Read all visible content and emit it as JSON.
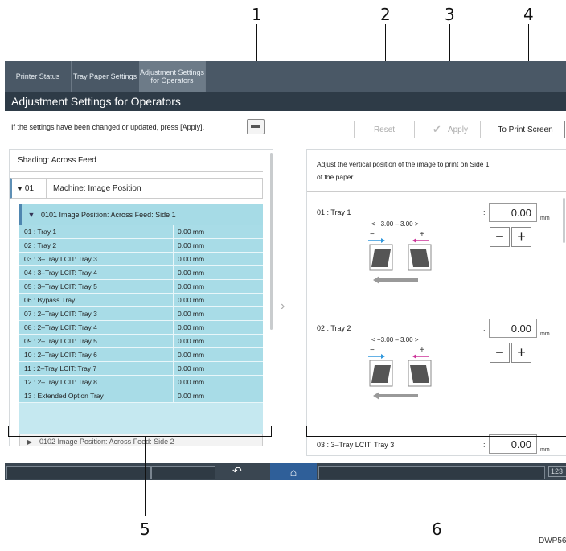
{
  "callouts": {
    "c1": "1",
    "c2": "2",
    "c3": "3",
    "c4": "4",
    "c5": "5",
    "c6": "6"
  },
  "tabs": [
    {
      "label": "Printer Status"
    },
    {
      "label": "Tray Paper Settings"
    },
    {
      "label": "Adjustment Settings for Operators"
    }
  ],
  "title": "Adjustment Settings for Operators",
  "notice": "If the settings have been changed or updated, press [Apply].",
  "buttons": {
    "reset": "Reset",
    "apply": "Apply",
    "print_screen": "To Print Screen"
  },
  "left": {
    "shading": "Shading: Across Feed",
    "machine_code": "01",
    "machine_label": "Machine: Image Position",
    "group_label": "0101 Image Position: Across Feed: Side 1",
    "rows": [
      {
        "name": "01 : Tray 1",
        "value": "0.00 mm"
      },
      {
        "name": "02 : Tray 2",
        "value": "0.00 mm"
      },
      {
        "name": "03 : 3–Tray LCIT: Tray 3",
        "value": "0.00 mm"
      },
      {
        "name": "04 : 3–Tray LCIT: Tray 4",
        "value": "0.00 mm"
      },
      {
        "name": "05 : 3–Tray LCIT: Tray 5",
        "value": "0.00 mm"
      },
      {
        "name": "06 : Bypass Tray",
        "value": "0.00 mm"
      },
      {
        "name": "07 : 2–Tray LCIT: Tray 3",
        "value": "0.00 mm"
      },
      {
        "name": "08 : 2–Tray LCIT: Tray 4",
        "value": "0.00 mm"
      },
      {
        "name": "09 : 2–Tray LCIT: Tray 5",
        "value": "0.00 mm"
      },
      {
        "name": "10 : 2–Tray LCIT: Tray 6",
        "value": "0.00 mm"
      },
      {
        "name": "11 : 2–Tray LCIT: Tray 7",
        "value": "0.00 mm"
      },
      {
        "name": "12 : 2–Tray LCIT: Tray 8",
        "value": "0.00 mm"
      },
      {
        "name": "13 : Extended Option Tray",
        "value": "0.00 mm"
      }
    ],
    "group2_label": "0102 Image Position: Across Feed: Side 2"
  },
  "right": {
    "description": "Adjust the vertical position of the image to print on Side 1 of the paper.",
    "items": [
      {
        "label": "01 : Tray 1",
        "value": "0.00",
        "unit": "mm",
        "range": "< −3.00 – 3.00 >"
      },
      {
        "label": "02 : Tray 2",
        "value": "0.00",
        "unit": "mm",
        "range": "< −3.00 – 3.00 >"
      },
      {
        "label": "03 : 3–Tray LCIT: Tray 3",
        "value": "0.00",
        "unit": "mm"
      }
    ],
    "colon": ":",
    "minus": "−",
    "plus": "+"
  },
  "taskbar": {
    "ime": "123"
  },
  "footnote": "DWP56",
  "icons": {
    "pin": "keep-panel-icon",
    "check": "check-icon",
    "back": "back-arrow-icon",
    "home": "home-icon"
  },
  "colors": {
    "tabbar": "#4a5866",
    "titlebar": "#2e3b47",
    "row_bg": "#a8dce7",
    "home_bg": "#2f5f99"
  }
}
